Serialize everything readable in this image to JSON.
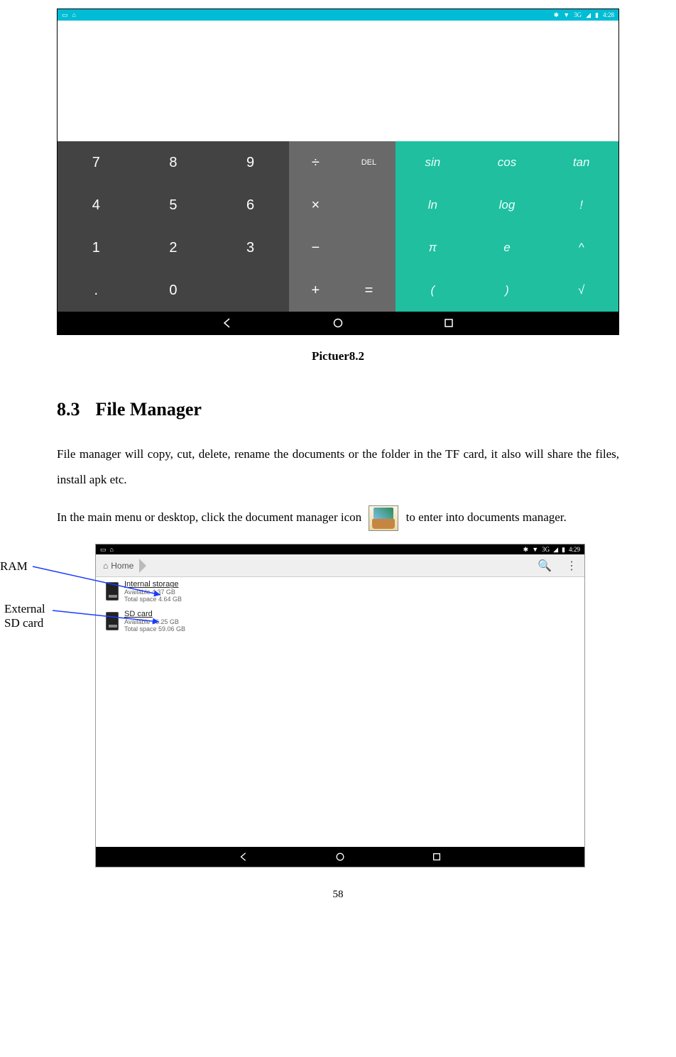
{
  "calc": {
    "status_time": "4:28",
    "status_net": "3G",
    "num_keys": [
      "7",
      "8",
      "9",
      "4",
      "5",
      "6",
      "1",
      "2",
      "3",
      ".",
      "0",
      ""
    ],
    "op_keys": [
      "÷",
      "DEL",
      "×",
      "",
      "−",
      "",
      "+",
      "="
    ],
    "func_keys": [
      "sin",
      "cos",
      "tan",
      "ln",
      "log",
      "!",
      "π",
      "e",
      "^",
      "(",
      ")",
      "√"
    ],
    "caption": "Pictuer8.2"
  },
  "section": {
    "num": "8.3",
    "title": "File Manager",
    "para1": "File manager will copy, cut, delete, rename the documents or the folder in the TF card, it also will share the files, install apk etc.",
    "para2a": "In the main menu or desktop, click the document manager icon ",
    "para2b": " to enter into documents manager."
  },
  "annot": {
    "ram": "RAM",
    "sd_line1": "External",
    "sd_line2": "SD card"
  },
  "fm": {
    "status_time": "4:29",
    "status_net": "3G",
    "home_label": "Home",
    "item1_title": "Internal storage",
    "item1_avail": "Available 4.37 GB",
    "item1_total": "Total space 4.64 GB",
    "item2_title": "SD card",
    "item2_avail": "Available 46.25 GB",
    "item2_total": "Total space 59.06 GB"
  },
  "page_number": "58"
}
